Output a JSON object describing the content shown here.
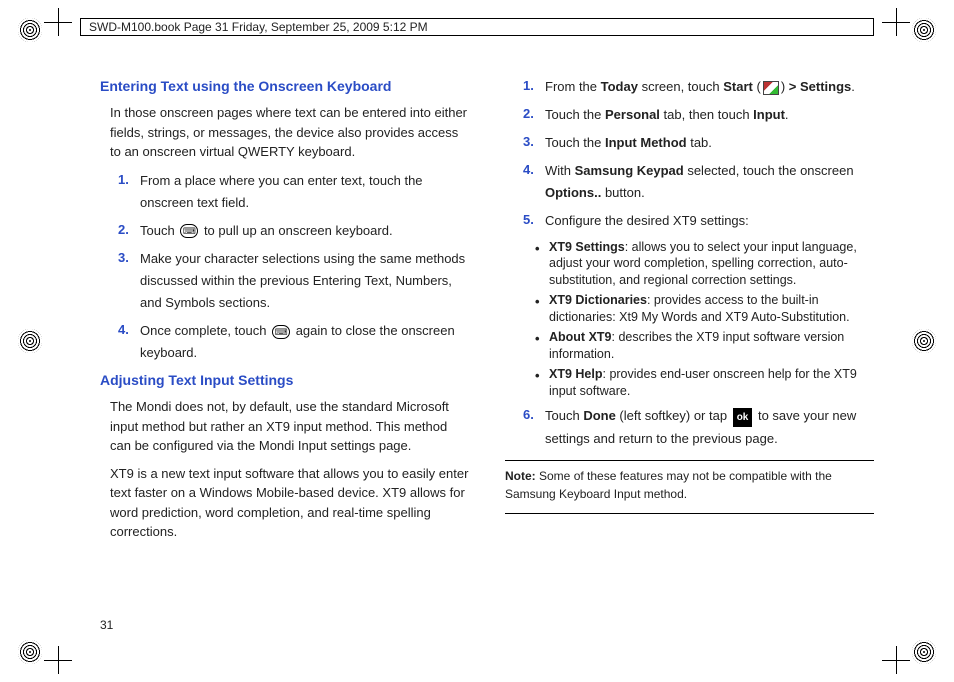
{
  "header": {
    "title": "SWD-M100.book  Page 31  Friday, September 25, 2009  5:12 PM"
  },
  "page_number": "31",
  "left": {
    "h1": "Entering Text using the Onscreen Keyboard",
    "p1": "In those onscreen pages where text can be entered into either fields, strings, or messages, the device also provides access to an onscreen virtual QWERTY keyboard.",
    "steps": {
      "n1": "1.",
      "t1": "From a place where you can enter text, touch the onscreen text field.",
      "n2": "2.",
      "t2a": "Touch ",
      "t2b": " to pull up an onscreen keyboard.",
      "n3": "3.",
      "t3": "Make your character selections using the same methods discussed within the previous Entering Text, Numbers, and Symbols sections.",
      "n4": "4.",
      "t4a": "Once complete, touch ",
      "t4b": " again to close the onscreen keyboard."
    },
    "h2": "Adjusting Text Input Settings",
    "p2": "The Mondi does not, by default, use the standard Microsoft input method but rather an XT9 input method. This method can be configured via the Mondi Input settings page.",
    "p3": "XT9 is a new text input software that allows you to easily enter text faster on a Windows Mobile-based device. XT9 allows for word prediction, word completion, and real-time spelling corrections."
  },
  "right": {
    "steps": {
      "n1": "1.",
      "t1a": "From the ",
      "t1b": "Today",
      "t1c": " screen, touch ",
      "t1d": "Start",
      "t1e": " (",
      "t1f": ") ",
      "t1g": "> Settings",
      "t1h": ".",
      "n2": "2.",
      "t2a": "Touch the ",
      "t2b": "Personal",
      "t2c": " tab, then touch ",
      "t2d": "Input",
      "t2e": ".",
      "n3": "3.",
      "t3a": "Touch the ",
      "t3b": "Input Method",
      "t3c": " tab.",
      "n4": "4.",
      "t4a": "With ",
      "t4b": "Samsung Keypad",
      "t4c": " selected, touch the onscreen ",
      "t4d": "Options..",
      "t4e": " button.",
      "n5": "5.",
      "t5": "Configure the desired XT9 settings:",
      "b1a": "XT9 Settings",
      "b1b": ": allows you to select your input language, adjust your word completion, spelling correction, auto-substitution, and regional correction settings.",
      "b2a": "XT9 Dictionaries",
      "b2b": ": provides access to the built-in dictionaries: Xt9 My Words and XT9 Auto-Substitution.",
      "b3a": "About XT9",
      "b3b": ": describes the XT9 input software version information.",
      "b4a": "XT9 Help",
      "b4b": ": provides end-user onscreen help for the XT9 input software.",
      "n6": "6.",
      "t6a": "Touch ",
      "t6b": "Done",
      "t6c": " (left softkey) or tap ",
      "t6d": " to save your new settings and return to the previous page."
    },
    "note_label": "Note:",
    "note_text": " Some of these features may not be compatible with the Samsung Keyboard Input method."
  },
  "icons": {
    "keyboard_toggle": "keyboard-toggle-icon",
    "start_flag": "start-flag-icon",
    "ok": "ok"
  }
}
